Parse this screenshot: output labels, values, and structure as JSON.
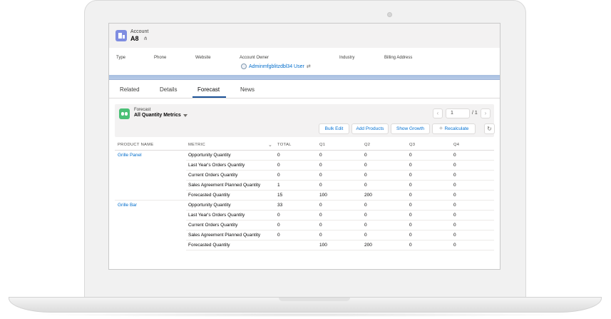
{
  "account": {
    "type_label": "Account",
    "name": "A8",
    "hierarchy_icon": "hierarchy-icon",
    "fields": {
      "type": "Type",
      "phone": "Phone",
      "website": "Website",
      "owner": "Account Owner",
      "industry": "Industry",
      "billing_address": "Billing Address"
    },
    "owner_name": "Adminmfgblitzdbl34 User",
    "colors": {
      "account_icon": "#7f8de1",
      "link": "#006dcc",
      "band": "#b0c5e3"
    }
  },
  "tabs": [
    {
      "label": "Related"
    },
    {
      "label": "Details"
    },
    {
      "label": "Forecast",
      "active": true
    },
    {
      "label": "News"
    }
  ],
  "forecast": {
    "label": "Forecast",
    "list_view": "All Quantity Metrics",
    "icon": "binoculars-icon",
    "icon_color": "#4bc076",
    "pagination": {
      "prev": "‹",
      "next": "›",
      "page": "1",
      "total": "/ 1"
    },
    "buttons": {
      "bulk_edit": "Bulk Edit",
      "add_products": "Add Products",
      "show_growth": "Show Growth",
      "recalculate": "Recalculate",
      "refresh": "↻"
    }
  },
  "table": {
    "headers": {
      "product": "PRODUCT NAME",
      "metric": "METRIC",
      "total": "TOTAL",
      "q1": "Q1",
      "q2": "Q2",
      "q3": "Q3",
      "q4": "Q4"
    },
    "rows": [
      {
        "product": "Grille Panel",
        "metric": "Opportunity Quantity",
        "total": "0",
        "q1": "0",
        "q2": "0",
        "q3": "0",
        "q4": "0"
      },
      {
        "product": "",
        "metric": "Last Year's Orders Quantity",
        "total": "0",
        "q1": "0",
        "q2": "0",
        "q3": "0",
        "q4": "0"
      },
      {
        "product": "",
        "metric": "Current Orders Quantity",
        "total": "0",
        "q1": "0",
        "q2": "0",
        "q3": "0",
        "q4": "0"
      },
      {
        "product": "",
        "metric": "Sales Agreement Planned Quantity",
        "total": "1",
        "q1": "0",
        "q2": "0",
        "q3": "0",
        "q4": "0"
      },
      {
        "product": "",
        "metric": "Forecasted Quantity",
        "total": "15",
        "q1": "100",
        "q2": "200",
        "q3": "0",
        "q4": "0"
      },
      {
        "product": "Grille Bar",
        "metric": "Opportunity Quantity",
        "total": "33",
        "q1": "0",
        "q2": "0",
        "q3": "0",
        "q4": "0"
      },
      {
        "product": "",
        "metric": "Last Year's Orders Quantity",
        "total": "0",
        "q1": "0",
        "q2": "0",
        "q3": "0",
        "q4": "0"
      },
      {
        "product": "",
        "metric": "Current Orders Quantity",
        "total": "0",
        "q1": "0",
        "q2": "0",
        "q3": "0",
        "q4": "0"
      },
      {
        "product": "",
        "metric": "Sales Agreement Planned Quantity",
        "total": "0",
        "q1": "0",
        "q2": "0",
        "q3": "0",
        "q4": "0"
      },
      {
        "product": "",
        "metric": "Forecasted Quantity",
        "total": "",
        "q1": "100",
        "q2": "200",
        "q3": "0",
        "q4": "0"
      }
    ]
  }
}
